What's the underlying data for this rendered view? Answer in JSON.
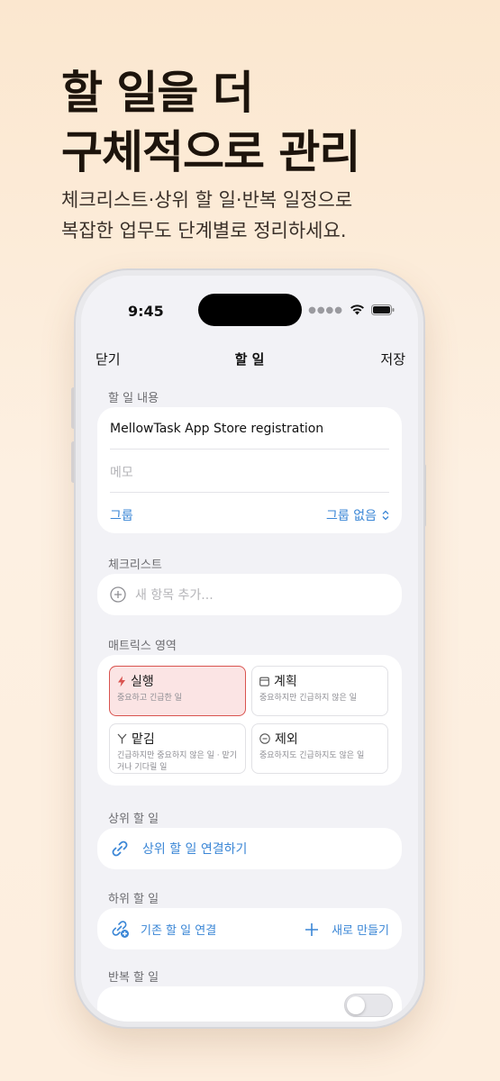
{
  "promo": {
    "headline_line1": "할 일을 더",
    "headline_line2": "구체적으로 관리",
    "subline_line1": "체크리스트·상위 할 일·반복 일정으로",
    "subline_line2": "복잡한 업무도 단계별로 정리하세요."
  },
  "status_bar": {
    "time": "9:45"
  },
  "nav": {
    "close_label": "닫기",
    "title": "할 일",
    "save_label": "저장"
  },
  "content": {
    "section_label": "할 일 내용",
    "task_title": "MellowTask App Store registration",
    "memo_placeholder": "메모",
    "group_label": "그룹",
    "group_value": "그룹 없음"
  },
  "checklist": {
    "section_label": "체크리스트",
    "add_placeholder": "새 항목 추가..."
  },
  "matrix": {
    "section_label": "매트릭스 영역",
    "cells": [
      {
        "title": "실행",
        "desc": "중요하고 긴급한 일",
        "selected": true
      },
      {
        "title": "계획",
        "desc": "중요하지만 긴급하지 않은 일",
        "selected": false
      },
      {
        "title": "맡김",
        "desc": "긴급하지만 중요하지 않은 일 · 맡기거나 기다릴 일",
        "selected": false
      },
      {
        "title": "제외",
        "desc": "중요하지도 긴급하지도 않은 일",
        "selected": false
      }
    ]
  },
  "parent": {
    "section_label": "상위 할 일",
    "link_label": "상위 할 일 연결하기"
  },
  "subtasks": {
    "section_label": "하위 할 일",
    "link_existing_label": "기존 할 일 연결",
    "create_new_label": "새로 만들기"
  },
  "repeat": {
    "section_label": "반복 할 일",
    "enabled": false
  },
  "colors": {
    "accent_blue": "#3a86d6",
    "selected_red": "#d9534f",
    "selected_bg": "#fbe4e4"
  }
}
